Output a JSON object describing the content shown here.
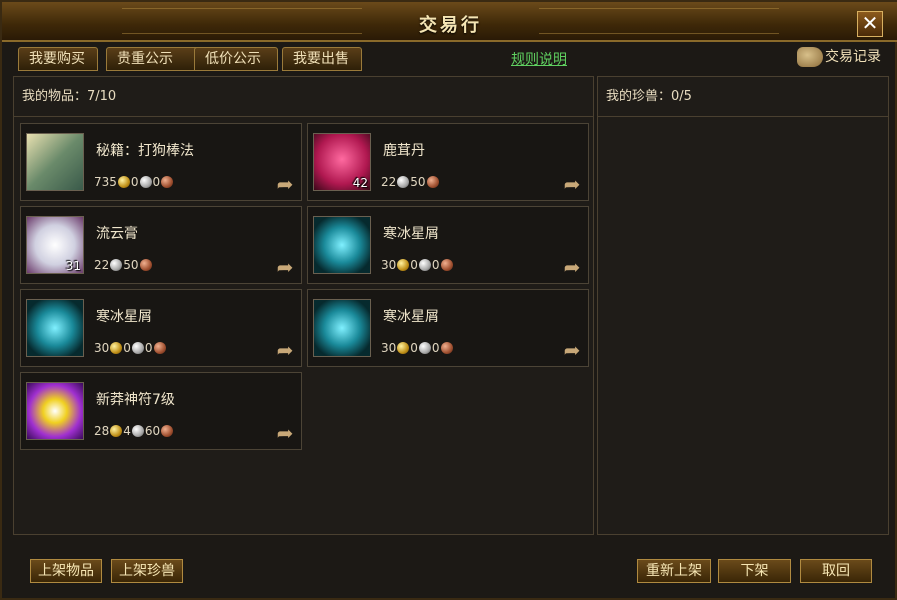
{
  "window": {
    "title": "交易行",
    "close_label": "✕"
  },
  "tabs": [
    {
      "label": "我要购买"
    },
    {
      "label": "贵重公示"
    },
    {
      "label": "低价公示"
    },
    {
      "label": "我要出售"
    }
  ],
  "rules_link": "规则说明",
  "history_label": "交易记录",
  "left_panel": {
    "header": "我的物品：7/10"
  },
  "right_panel": {
    "header": "我的珍兽：0/5"
  },
  "items": [
    {
      "name": "秘籍：打狗棒法",
      "icon": "scroll-tome",
      "count": "",
      "price": [
        "735",
        "0",
        "0"
      ]
    },
    {
      "name": "鹿茸丹",
      "icon": "deer-pill",
      "count": "42",
      "price": [
        "",
        "22",
        "50"
      ]
    },
    {
      "name": "流云膏",
      "icon": "cloud-ointment",
      "count": "31",
      "price": [
        "",
        "22",
        "50"
      ]
    },
    {
      "name": "寒冰星屑",
      "icon": "frost-dust",
      "count": "",
      "price": [
        "30",
        "0",
        "0"
      ]
    },
    {
      "name": "寒冰星屑",
      "icon": "frost-dust",
      "count": "",
      "price": [
        "30",
        "0",
        "0"
      ]
    },
    {
      "name": "寒冰星屑",
      "icon": "frost-dust",
      "count": "",
      "price": [
        "30",
        "0",
        "0"
      ]
    },
    {
      "name": "新莽神符7级",
      "icon": "rune",
      "count": "",
      "price": [
        "28",
        "4",
        "60"
      ]
    }
  ],
  "buttons": {
    "list_item": "上架物品",
    "list_pet": "上架珍兽",
    "relist": "重新上架",
    "delist": "下架",
    "cancel": "取回"
  }
}
